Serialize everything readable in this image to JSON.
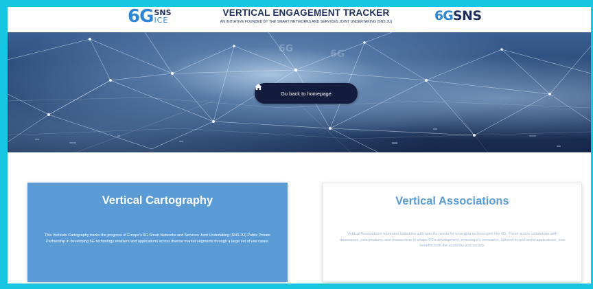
{
  "header": {
    "logo_left": {
      "primary": "6G",
      "top": "SNS",
      "bottom": "ICE"
    },
    "title": "VERTICAL ENGAGEMENT TRACKER",
    "subtitle": "AN INITIATIVE FOUNDED BY THE SMART NETWORKS AND SERVICES JOINT UNDERTAKING (SNS JU)",
    "logo_right": {
      "primary": "6G",
      "secondary": "SNS"
    }
  },
  "hero": {
    "home_button": {
      "label": "Go back to homepage",
      "icon": "home-icon"
    },
    "background_labels": [
      "6G",
      "6G"
    ]
  },
  "cards": [
    {
      "title": "Vertical Cartography",
      "description": "This Verticals Cartography tracks the progress of Europe's 6G Smart Networks and Services Joint Undertaking (SNS JU) Public Private Partnership in developing 6G technology enablers and applications across diverse market segments through a large set of use cases."
    },
    {
      "title": "Vertical Associations",
      "description": "Vertical Associations represent industries with specific needs for emerging technologies like 6G. These actors collaborate with developers, policymakers, and researchers to shape 6G's development, ensuring it's innovative, tailored to real-world applications, and benefits both the economy and society."
    }
  ],
  "colors": {
    "frame": "#16c6e2",
    "navy": "#1d2d5c",
    "brand_blue": "#2e86d4",
    "card_blue": "#5b9bd5",
    "button_bg": "#141c3e"
  }
}
